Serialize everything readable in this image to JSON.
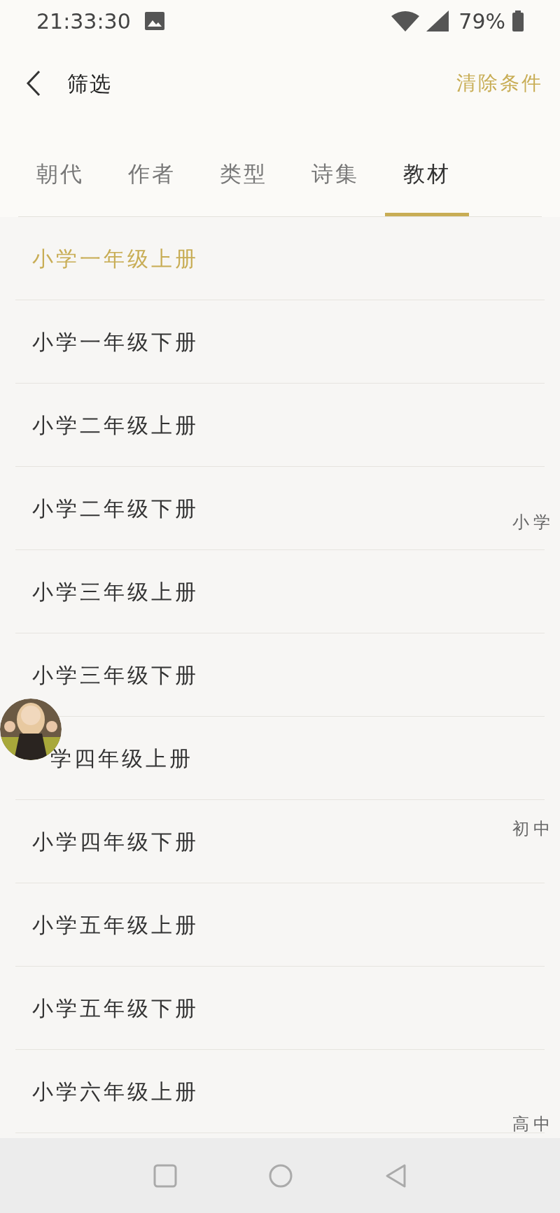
{
  "status_bar": {
    "time": "21:33:30",
    "battery": "79%"
  },
  "header": {
    "title": "筛选",
    "action": "清除条件"
  },
  "tabs": [
    {
      "label": "朝代",
      "selected": false
    },
    {
      "label": "作者",
      "selected": false
    },
    {
      "label": "类型",
      "selected": false
    },
    {
      "label": "诗集",
      "selected": false
    },
    {
      "label": "教材",
      "selected": true
    }
  ],
  "items": [
    {
      "label": "小学一年级上册",
      "selected": true,
      "kind": "plain"
    },
    {
      "label": "小学一年级下册",
      "selected": false,
      "kind": "plain"
    },
    {
      "label": "小学二年级上册",
      "selected": false,
      "kind": "plain"
    },
    {
      "label": "小学二年级下册",
      "selected": false,
      "kind": "plain"
    },
    {
      "label": "小学三年级上册",
      "selected": false,
      "kind": "plain"
    },
    {
      "label": "小学三年级下册",
      "selected": false,
      "kind": "plain"
    },
    {
      "label": "学四年级上册",
      "selected": false,
      "kind": "covered"
    },
    {
      "label": "小学四年级下册",
      "selected": false,
      "kind": "plain"
    },
    {
      "label": "小学五年级上册",
      "selected": false,
      "kind": "plain"
    },
    {
      "label": "小学五年级下册",
      "selected": false,
      "kind": "plain"
    },
    {
      "label": "小学六年级上册",
      "selected": false,
      "kind": "plain"
    }
  ],
  "index": [
    "小学",
    "初中",
    "高中"
  ]
}
